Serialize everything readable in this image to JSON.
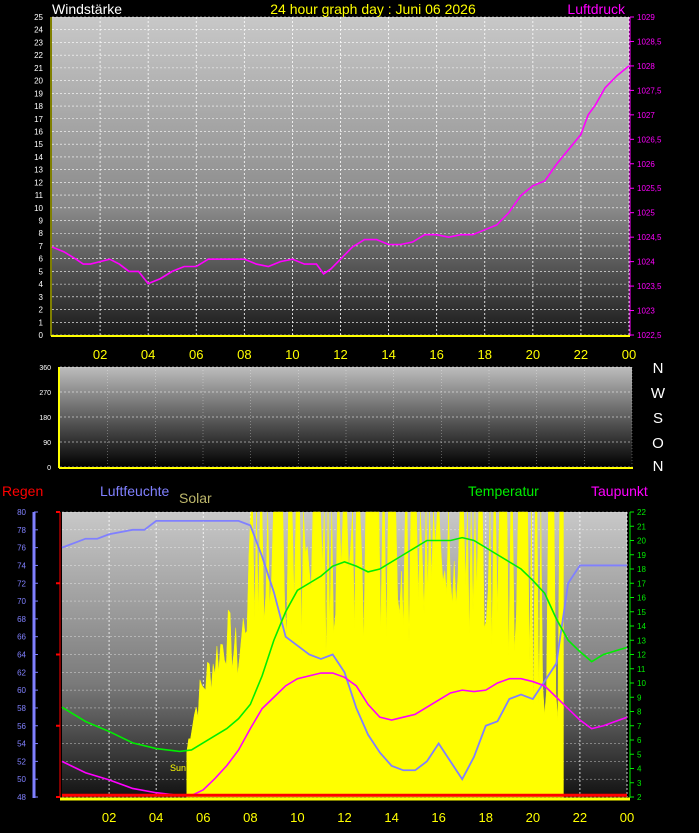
{
  "header": {
    "left": "Windstärke",
    "center": "24 hour graph day : Juni 06 2026",
    "right": "Luftdruck"
  },
  "compass": [
    "N",
    "W",
    "S",
    "O",
    "N"
  ],
  "legend2": {
    "regen": "Regen",
    "luftfeuchte": "Luftfeuchte",
    "solar": "Solar",
    "temperatur": "Temperatur",
    "taupunkt": "Taupunkt",
    "sun": "Sun"
  },
  "colors": {
    "wind": "#ffffff",
    "pressure": "#ff00ff",
    "rain": "#ff0000",
    "humidity": "#8080ff",
    "solar": "#ffff00",
    "temperature": "#00ee00",
    "dewpoint": "#ff00ff",
    "axis": "#ffff00"
  },
  "chart_data": [
    {
      "type": "line",
      "title": "24 hour graph day : Juni 06 2026",
      "x_ticks": [
        "02",
        "04",
        "06",
        "08",
        "10",
        "12",
        "14",
        "16",
        "18",
        "20",
        "22",
        "00"
      ],
      "y_left_ticks": [
        "0",
        "1",
        "2",
        "3",
        "4",
        "5",
        "6",
        "7",
        "8",
        "9",
        "10",
        "11",
        "12",
        "13",
        "14",
        "15",
        "16",
        "17",
        "18",
        "19",
        "20",
        "21",
        "22",
        "23",
        "24",
        "25"
      ],
      "y_left_range": [
        0,
        25
      ],
      "y_right_ticks": [
        "1022,5",
        "1023",
        "1023,5",
        "1024",
        "1024,5",
        "1025",
        "1025,5",
        "1026",
        "1026,5",
        "1027",
        "1027,5",
        "1028",
        "1028,5",
        "1029"
      ],
      "y_right_range": [
        1022.5,
        1029
      ],
      "series": [
        {
          "name": "Luftdruck",
          "axis": "right",
          "x": [
            0,
            0.5,
            1,
            1.3,
            1.6,
            2,
            2.4,
            2.8,
            3.2,
            3.6,
            4,
            4.5,
            5,
            5.5,
            6,
            6.5,
            7,
            7.5,
            8,
            8.5,
            9,
            9.5,
            10,
            10.5,
            11,
            11.3,
            11.6,
            12,
            12.5,
            13,
            13.5,
            14,
            14.5,
            15,
            15.5,
            16,
            16.5,
            17,
            17.5,
            18,
            18.5,
            19,
            19.5,
            20,
            20.5,
            21,
            21.5,
            22,
            22.3,
            22.6,
            23,
            23.5,
            24
          ],
          "y": [
            1024.3,
            1024.2,
            1024.05,
            1023.95,
            1023.95,
            1024.0,
            1024.05,
            1023.95,
            1023.8,
            1023.8,
            1023.55,
            1023.65,
            1023.8,
            1023.9,
            1023.9,
            1024.05,
            1024.05,
            1024.05,
            1024.05,
            1023.95,
            1023.9,
            1024.0,
            1024.05,
            1023.95,
            1023.95,
            1023.75,
            1023.85,
            1024.05,
            1024.3,
            1024.45,
            1024.45,
            1024.35,
            1024.35,
            1024.4,
            1024.55,
            1024.55,
            1024.5,
            1024.55,
            1024.55,
            1024.65,
            1024.75,
            1025.0,
            1025.35,
            1025.55,
            1025.65,
            1026.0,
            1026.3,
            1026.6,
            1027.0,
            1027.2,
            1027.55,
            1027.8,
            1028.0
          ]
        }
      ]
    },
    {
      "type": "line",
      "title": "",
      "y_left_ticks": [
        "0",
        "90",
        "180",
        "270",
        "360"
      ],
      "y_left_range": [
        0,
        360
      ],
      "series": []
    },
    {
      "type": "line",
      "title": "",
      "x_ticks": [
        "02",
        "04",
        "06",
        "08",
        "10",
        "12",
        "14",
        "16",
        "18",
        "20",
        "22",
        "00"
      ],
      "y_left_ticks": [
        "48",
        "50",
        "52",
        "54",
        "56",
        "58",
        "60",
        "62",
        "64",
        "66",
        "68",
        "70",
        "72",
        "74",
        "76",
        "78",
        "80"
      ],
      "y_left_range": [
        48,
        80
      ],
      "y_right_ticks": [
        "2",
        "3",
        "4",
        "5",
        "6",
        "7",
        "8",
        "9",
        "10",
        "11",
        "12",
        "13",
        "14",
        "15",
        "16",
        "17",
        "18",
        "19",
        "20",
        "21",
        "22"
      ],
      "y_right_range": [
        2,
        22
      ],
      "series": [
        {
          "name": "Luftfeuchte",
          "axis": "left",
          "x": [
            0,
            0.5,
            1,
            1.5,
            2,
            3,
            3.5,
            4,
            5,
            5.5,
            6,
            7,
            7.5,
            8,
            8.5,
            9,
            9.5,
            10,
            10.5,
            11,
            11.5,
            12,
            12.5,
            13,
            13.5,
            14,
            14.5,
            15,
            15.5,
            16,
            16.5,
            17,
            17.5,
            18,
            18.5,
            19,
            19.5,
            20,
            20.5,
            21,
            21.5,
            22,
            22.5,
            23,
            24
          ],
          "y": [
            76,
            76.5,
            77,
            77,
            77.5,
            78,
            78,
            79,
            79,
            79,
            79,
            79,
            79,
            78.5,
            75,
            71,
            66,
            65,
            64,
            63.5,
            64,
            62,
            58,
            55,
            53,
            51.5,
            51,
            51,
            52,
            54,
            52,
            50,
            52.5,
            56,
            56.5,
            59,
            59.5,
            59,
            61,
            63,
            72,
            74,
            74,
            74,
            74
          ]
        },
        {
          "name": "Temperatur",
          "axis": "right",
          "x": [
            0,
            1,
            2,
            3,
            4,
            5,
            5.5,
            6,
            6.5,
            7,
            7.5,
            8,
            8.5,
            9,
            9.5,
            10,
            10.5,
            11,
            11.5,
            12,
            12.5,
            13,
            13.5,
            14,
            14.5,
            15,
            15.5,
            16,
            16.5,
            17,
            17.5,
            18,
            18.5,
            19,
            19.5,
            20,
            20.5,
            21,
            21.5,
            22,
            22.5,
            23,
            24
          ],
          "y": [
            8.3,
            7.3,
            6.6,
            5.8,
            5.4,
            5.2,
            5.3,
            5.8,
            6.3,
            6.8,
            7.5,
            8.5,
            10.5,
            13,
            15,
            16.5,
            17,
            17.5,
            18.2,
            18.5,
            18.2,
            17.8,
            18.0,
            18.5,
            19,
            19.5,
            20,
            20,
            20,
            20.2,
            20,
            19.5,
            19,
            18.5,
            18,
            17.2,
            16.3,
            14.5,
            13,
            12.2,
            11.5,
            12,
            12.5
          ]
        },
        {
          "name": "Taupunkt",
          "axis": "right",
          "x": [
            0,
            1,
            2,
            3,
            4,
            5,
            5.5,
            6,
            6.5,
            7,
            7.5,
            8,
            8.5,
            9,
            9.5,
            10,
            10.5,
            11,
            11.5,
            12,
            12.5,
            13,
            13.5,
            14,
            14.5,
            15,
            15.5,
            16,
            16.5,
            17,
            17.5,
            18,
            18.5,
            19,
            19.5,
            20,
            20.5,
            21,
            21.5,
            22,
            22.5,
            23,
            24
          ],
          "y": [
            4.5,
            3.7,
            3.2,
            2.6,
            2.3,
            2.1,
            2.1,
            2.5,
            3.3,
            4.2,
            5.3,
            6.8,
            8.2,
            9,
            9.8,
            10.3,
            10.5,
            10.7,
            10.7,
            10.4,
            9.8,
            8.5,
            7.6,
            7.4,
            7.6,
            7.8,
            8.3,
            8.8,
            9.3,
            9.5,
            9.4,
            9.5,
            10.0,
            10.3,
            10.3,
            10.1,
            9.8,
            9.0,
            8.2,
            7.4,
            6.8,
            7.0,
            7.6
          ]
        },
        {
          "name": "Regen",
          "axis": "left",
          "x": [
            0,
            24
          ],
          "y": [
            48.2,
            48.2
          ]
        }
      ],
      "solar_window": [
        5.3,
        21.3
      ],
      "solar_baseline": [
        0,
        0.5,
        1,
        1.5,
        2,
        2.5,
        3,
        3.5,
        4,
        4.5,
        5,
        5.5,
        6,
        6.5,
        7,
        7.5,
        8,
        8.5,
        9,
        9.5,
        10,
        10.5,
        11,
        11.5,
        12,
        12.5,
        13,
        13.5,
        14,
        14.5,
        15,
        15.5,
        16,
        16.5,
        17,
        17.5,
        18,
        18.5,
        19,
        19.5,
        20,
        20.5,
        21,
        21.5,
        22,
        22.5,
        23,
        23.5,
        24
      ],
      "solar_values": [
        0,
        0,
        0,
        0,
        0,
        0,
        0,
        0,
        0,
        0,
        0,
        0.3,
        0.45,
        0.55,
        0.65,
        0.55,
        0.85,
        0.95,
        0.9,
        0.8,
        0.95,
        0.9,
        0.95,
        0.75,
        0.9,
        0.95,
        0.85,
        0.95,
        0.95,
        0.9,
        0.95,
        0.85,
        0.95,
        0.95,
        0.85,
        0.95,
        0.9,
        0.8,
        0.7,
        0.65,
        0.45,
        0.4,
        0.45,
        0,
        0,
        0,
        0,
        0,
        0
      ]
    }
  ]
}
